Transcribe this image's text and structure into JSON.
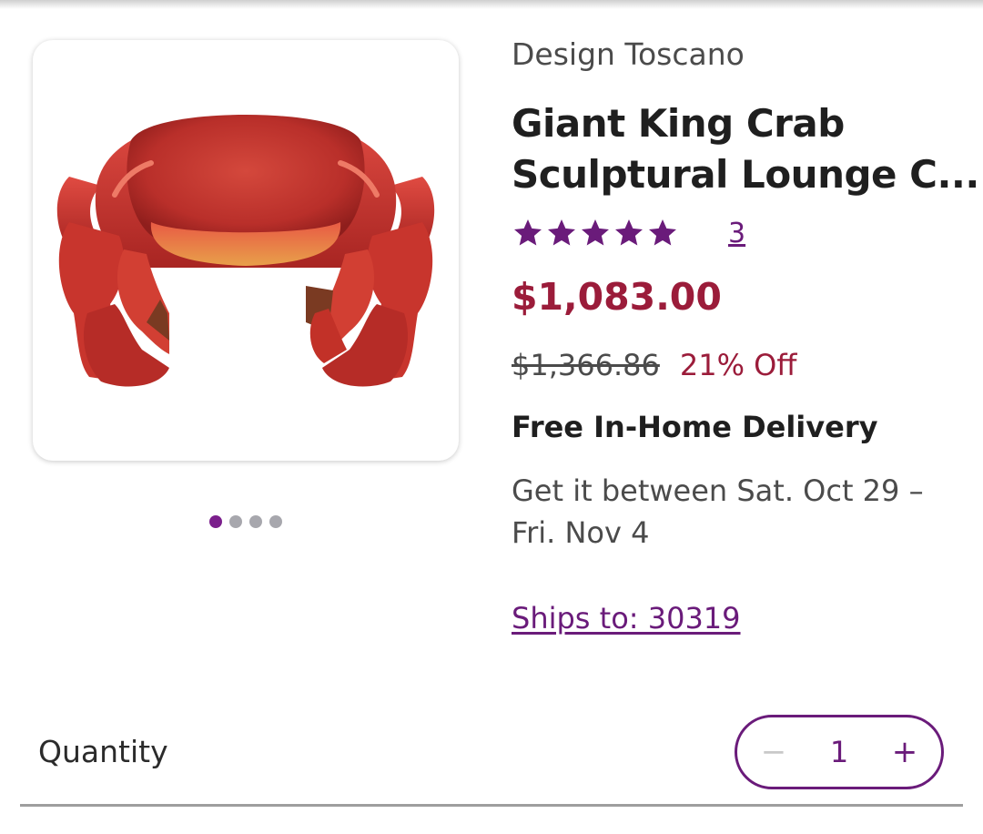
{
  "product": {
    "brand": "Design Toscano",
    "title_line1": "Giant King Crab",
    "title_line2": "Sculptural Lounge C...",
    "rating": {
      "stars": 5,
      "review_count": "3"
    },
    "price": "$1,083.00",
    "was_price": "$1,366.86",
    "discount": "21% Off",
    "image_icon": "crab-chair-product-image",
    "gallery": {
      "total_images": 4,
      "active_index": 0
    }
  },
  "delivery": {
    "title": "Free In-Home Delivery",
    "eta": "Get it between Sat. Oct 29 – Fri. Nov 4",
    "ships_to": "Ships to: 30319"
  },
  "quantity": {
    "label": "Quantity",
    "value": "1",
    "minus_icon": "−",
    "plus_icon": "+"
  },
  "colors": {
    "accent_purple": "#6a1b7a",
    "price_red": "#9b1c3a",
    "dot_active": "#7b1f8c",
    "dot_inactive": "#a7a7ad"
  }
}
